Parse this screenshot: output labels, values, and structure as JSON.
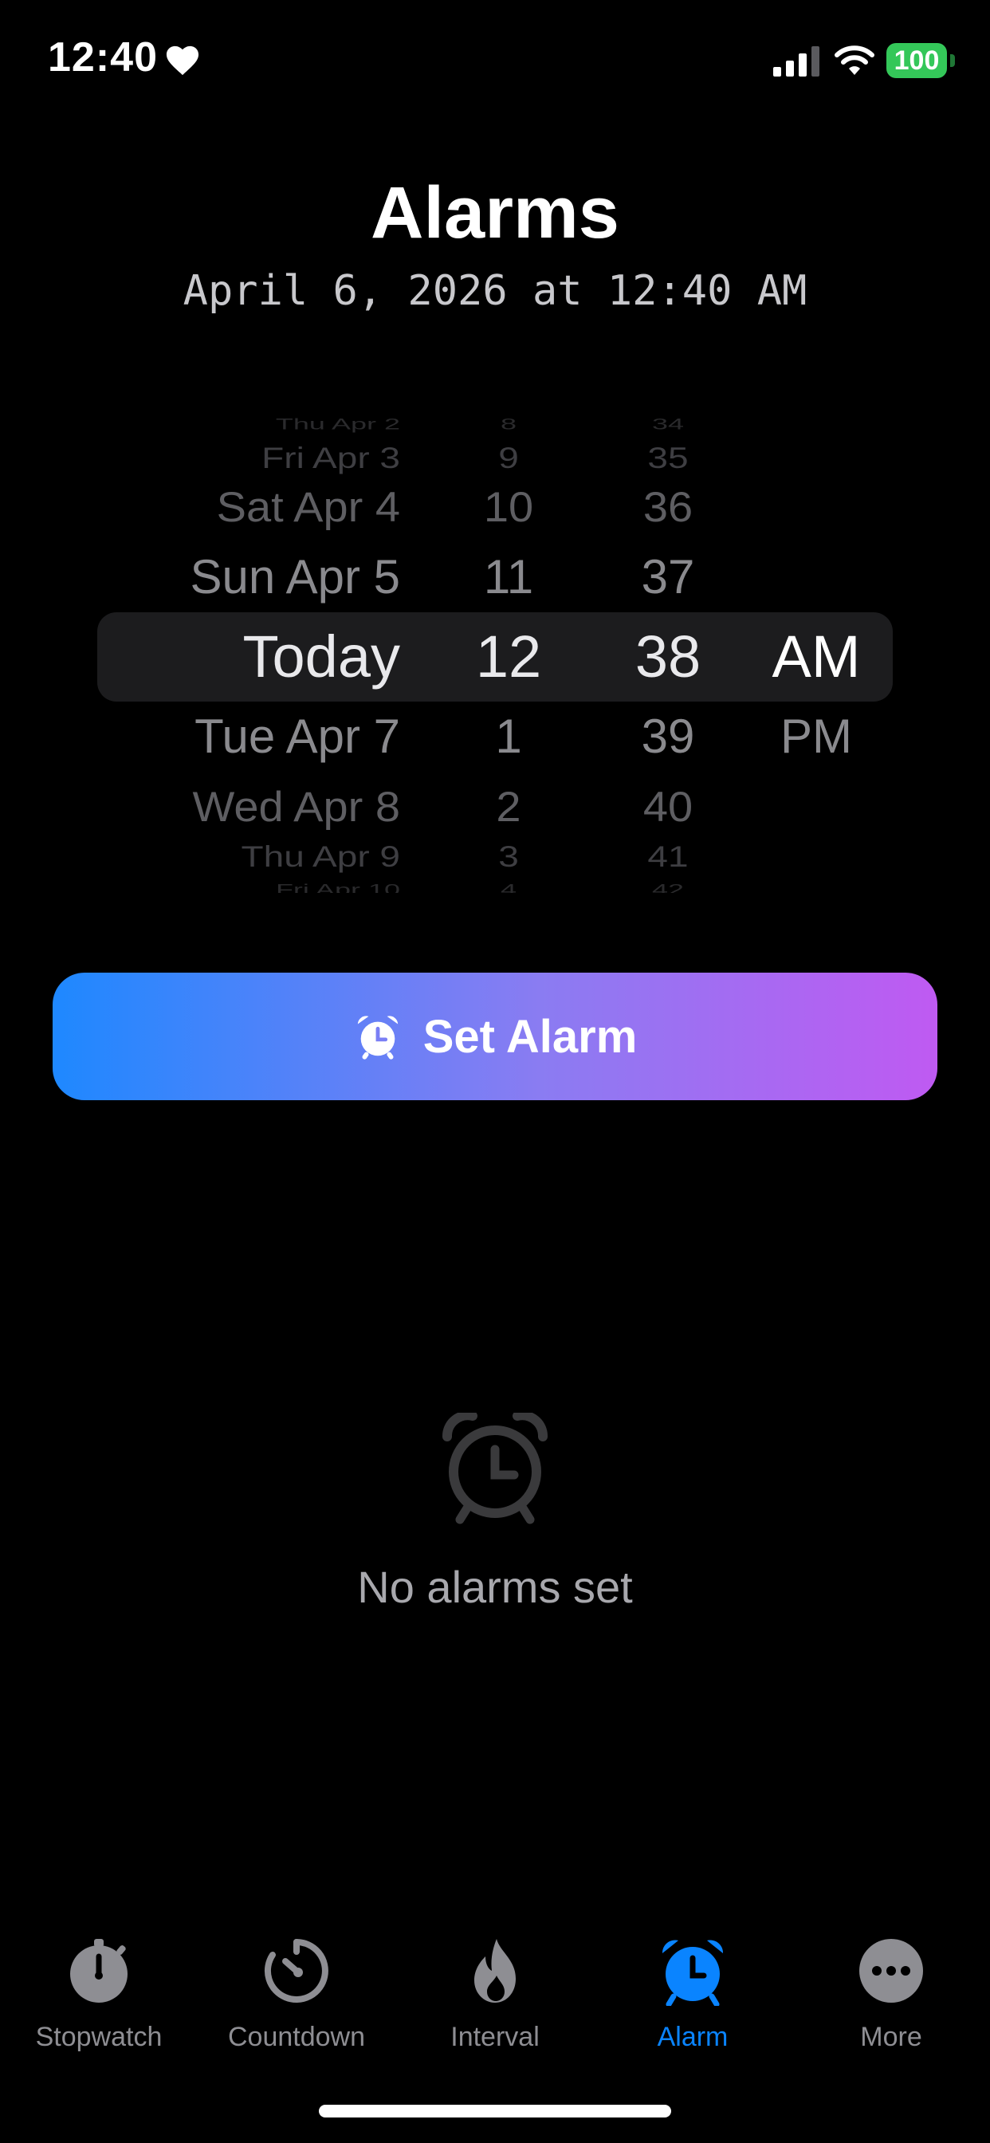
{
  "status_bar": {
    "time": "12:40",
    "battery": "100"
  },
  "header": {
    "title": "Alarms",
    "subtitle": "April 6, 2026 at 12:40 AM"
  },
  "picker": {
    "rows": [
      {
        "date": "Thu Apr 2",
        "hour": "8",
        "minute": "34",
        "ampm": ""
      },
      {
        "date": "Fri Apr 3",
        "hour": "9",
        "minute": "35",
        "ampm": ""
      },
      {
        "date": "Sat Apr 4",
        "hour": "10",
        "minute": "36",
        "ampm": ""
      },
      {
        "date": "Sun Apr 5",
        "hour": "11",
        "minute": "37",
        "ampm": ""
      },
      {
        "date": "Today",
        "hour": "12",
        "minute": "38",
        "ampm": "AM"
      },
      {
        "date": "Tue Apr 7",
        "hour": "1",
        "minute": "39",
        "ampm": "PM"
      },
      {
        "date": "Wed Apr 8",
        "hour": "2",
        "minute": "40",
        "ampm": ""
      },
      {
        "date": "Thu Apr 9",
        "hour": "3",
        "minute": "41",
        "ampm": ""
      },
      {
        "date": "Fri Apr 10",
        "hour": "4",
        "minute": "42",
        "ampm": ""
      }
    ],
    "selected_index": 4
  },
  "action": {
    "label": "Set Alarm",
    "icon": "alarm-clock-icon"
  },
  "empty_state": {
    "icon": "alarm-clock-icon",
    "message": "No alarms set"
  },
  "tab_bar": {
    "tabs": [
      {
        "label": "Stopwatch",
        "icon": "stopwatch-icon",
        "active": false
      },
      {
        "label": "Countdown",
        "icon": "countdown-icon",
        "active": false
      },
      {
        "label": "Interval",
        "icon": "flame-icon",
        "active": false
      },
      {
        "label": "Alarm",
        "icon": "alarm-clock-icon",
        "active": true
      },
      {
        "label": "More",
        "icon": "more-icon",
        "active": false
      }
    ]
  },
  "colors": {
    "accent": "#0A84FF",
    "gradient_start": "#1E88FF",
    "gradient_end": "#BF5AF2",
    "battery": "#34C759",
    "inactive": "#8E8E93"
  }
}
